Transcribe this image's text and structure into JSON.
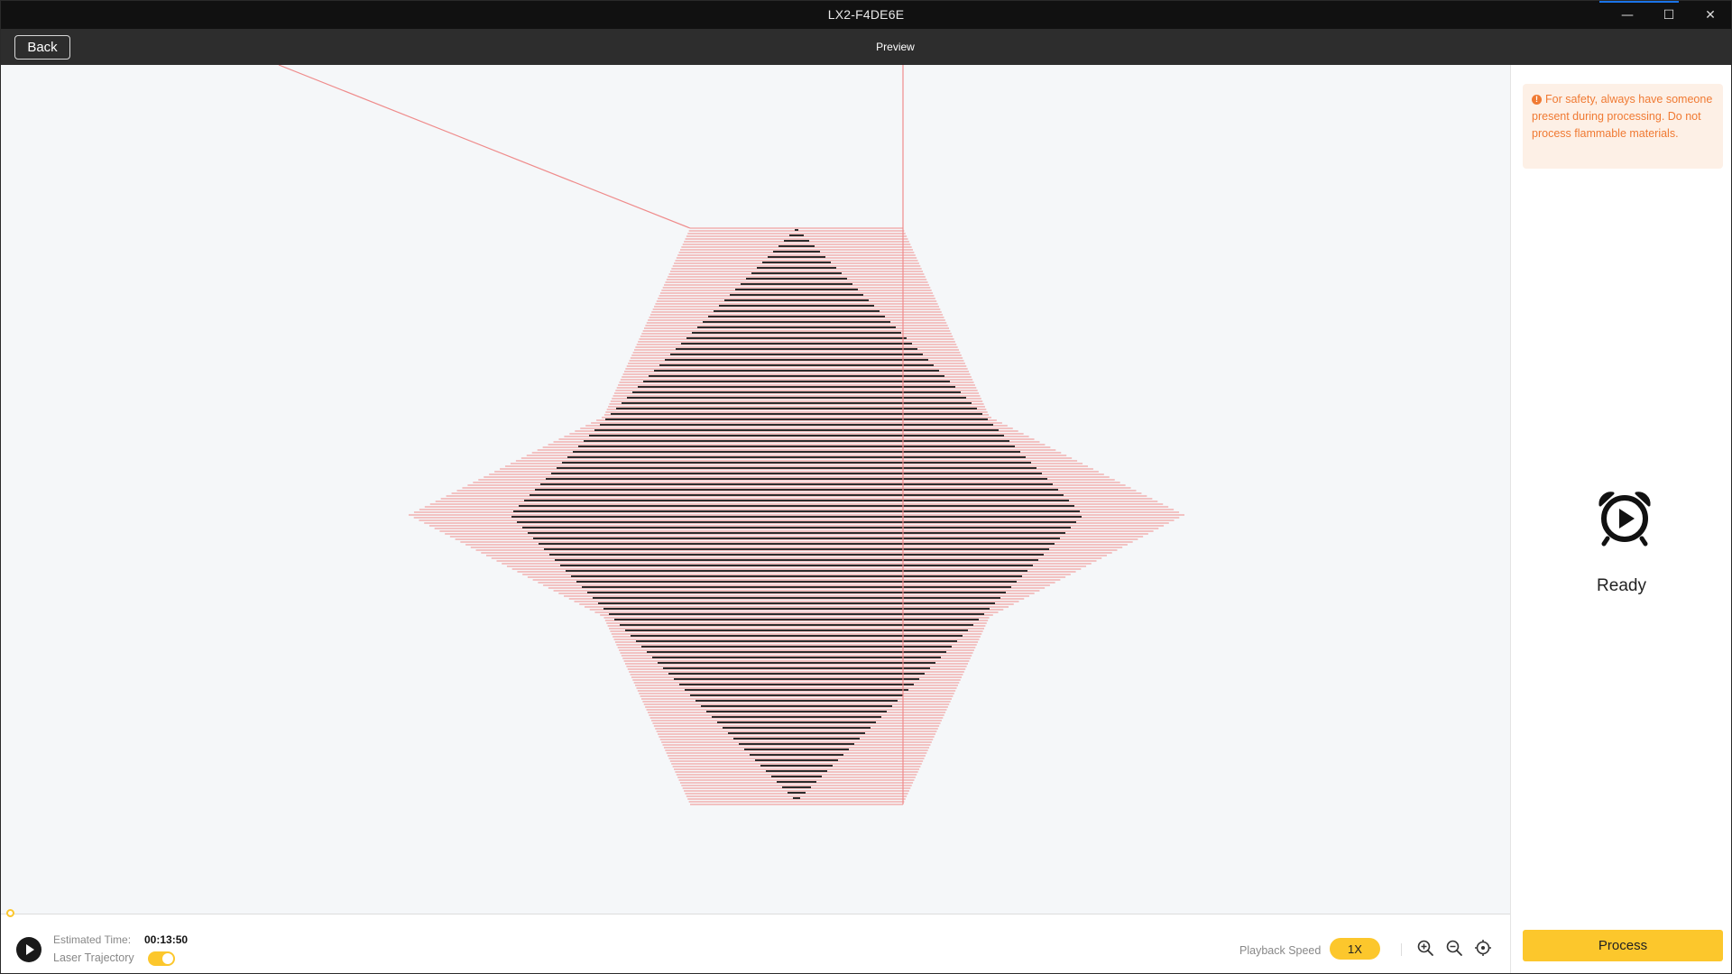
{
  "window": {
    "title": "LX2-F4DE6E",
    "minimize_glyph": "—",
    "maximize_glyph": "☐",
    "close_glyph": "✕"
  },
  "toolbar": {
    "back_label": "Back",
    "title": "Preview"
  },
  "safety_notice": {
    "icon": "exclamation-circle-icon",
    "text": "For safety, always have someone present during processing. Do not process flammable materials."
  },
  "status": {
    "icon": "alarm-clock-play-icon",
    "label": "Ready"
  },
  "process_label": "Process",
  "bottom_bar": {
    "estimated_time_label": "Estimated Time:",
    "estimated_time_value": "00:13:50",
    "trajectory_label": "Laser Trajectory",
    "trajectory_enabled": true,
    "playback_speed_label": "Playback Speed",
    "playback_speed_value": "1X",
    "progress": 0
  },
  "colors": {
    "accent": "#fcc72c",
    "warning": "#f07a33",
    "trajectory": "#ef8c8c",
    "engrave": "#2d2d2d",
    "canvas": "#f5f7f9"
  }
}
